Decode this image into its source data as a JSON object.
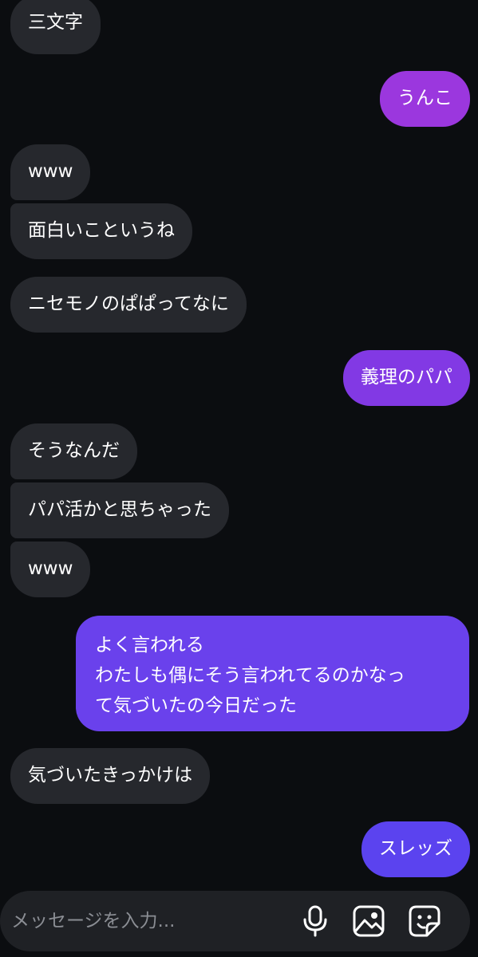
{
  "messages": [
    {
      "side": "in",
      "text": "三文字"
    },
    {
      "side": "out",
      "text": "うんこ"
    },
    {
      "side": "in",
      "text": "www"
    },
    {
      "side": "in",
      "text": "面白いこというね"
    },
    {
      "side": "in",
      "text": "ニセモノのぱぱってなに"
    },
    {
      "side": "out",
      "text": "義理のパパ"
    },
    {
      "side": "in",
      "text": "そうなんだ"
    },
    {
      "side": "in",
      "text": "パパ活かと思ちゃった"
    },
    {
      "side": "in",
      "text": "www"
    },
    {
      "side": "out",
      "lines": [
        "よく言われる",
        "わたしも偶にそう言われてるのかなっ",
        "て気づいたの今日だった"
      ]
    },
    {
      "side": "in",
      "text": "気づいたきっかけは"
    },
    {
      "side": "out",
      "text": "スレッズ"
    }
  ],
  "composer": {
    "placeholder": "メッセージを入力...",
    "icons": [
      "microphone-icon",
      "image-icon",
      "sticker-icon"
    ]
  },
  "colors": {
    "background": "#0b0d10",
    "incoming_bubble": "#26282d",
    "outgoing_gradient": [
      "#9b37de",
      "#7a3ee8",
      "#5b43ef"
    ],
    "composer": "#1f2125",
    "placeholder": "#8b8e94"
  }
}
